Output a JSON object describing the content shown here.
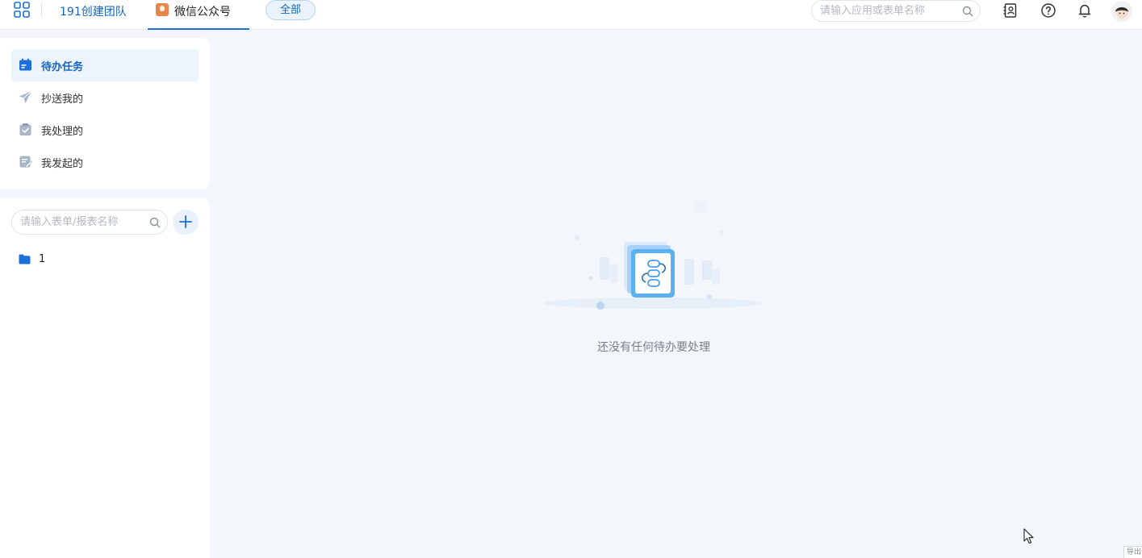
{
  "topbar": {
    "team_name": "191创建团队",
    "app_name": "微信公众号",
    "filter_pill": "全部",
    "search_placeholder": "请输入应用或表单名称",
    "icons": [
      "apps-grid-icon",
      "contacts-icon",
      "help-icon",
      "bell-icon",
      "avatar"
    ],
    "accent_color": "#1e6fd9"
  },
  "sidebar": {
    "nav_items": [
      {
        "label": "待办任务",
        "icon": "calendar-todo-icon",
        "active": true
      },
      {
        "label": "抄送我的",
        "icon": "paper-plane-icon",
        "active": false
      },
      {
        "label": "我处理的",
        "icon": "clipboard-check-icon",
        "active": false
      },
      {
        "label": "我发起的",
        "icon": "edit-form-icon",
        "active": false
      }
    ],
    "form_search_placeholder": "请输入表单/报表名称",
    "folders": [
      {
        "label": "1",
        "icon": "folder-icon"
      }
    ]
  },
  "main": {
    "empty_message": "还没有任何待办要处理"
  },
  "corner_widget": {
    "text": "导出"
  }
}
